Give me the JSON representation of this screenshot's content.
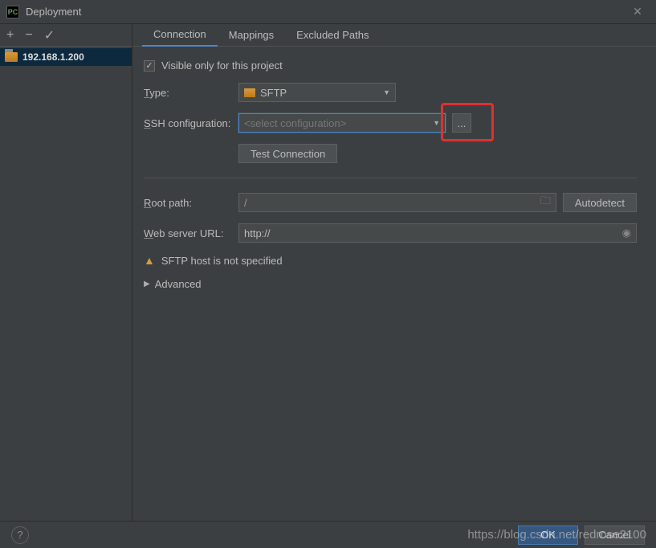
{
  "window": {
    "title": "Deployment",
    "app_icon_text": "PC"
  },
  "sidebar": {
    "server": "192.168.1.200"
  },
  "tabs": [
    {
      "label": "Connection",
      "active": true
    },
    {
      "label": "Mappings",
      "active": false
    },
    {
      "label": "Excluded Paths",
      "active": false
    }
  ],
  "form": {
    "visible_only_label": "Visible only for this project",
    "visible_only_checked": true,
    "type_label": "Type:",
    "type_value": "SFTP",
    "ssh_label": "SSH configuration:",
    "ssh_placeholder": "<select configuration>",
    "ellipsis": "...",
    "test_connection_label": "Test Connection",
    "root_path_label": "Root path:",
    "root_path_value": "/",
    "autodetect_label": "Autodetect",
    "web_url_label": "Web server URL:",
    "web_url_value": "http://",
    "warning_text": "SFTP host is not specified",
    "advanced_label": "Advanced"
  },
  "footer": {
    "ok": "OK",
    "cancel": "Cancel",
    "help": "?"
  },
  "watermark": "https://blog.csdn.net/redrose2100"
}
